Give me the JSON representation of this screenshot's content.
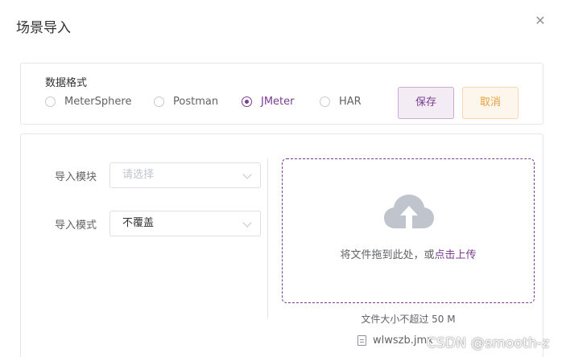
{
  "dialog": {
    "title": "场景导入",
    "close_icon": "close-icon"
  },
  "format": {
    "label": "数据格式",
    "options": [
      {
        "label": "MeterSphere",
        "selected": false
      },
      {
        "label": "Postman",
        "selected": false
      },
      {
        "label": "JMeter",
        "selected": true
      },
      {
        "label": "HAR",
        "selected": false
      }
    ],
    "save_label": "保存",
    "cancel_label": "取消"
  },
  "form": {
    "module_label": "导入模块",
    "module_placeholder": "请选择",
    "mode_label": "导入模式",
    "mode_value": "不覆盖"
  },
  "upload": {
    "icon": "cloud-upload-icon",
    "text_prefix": "将文件拖到此处，或",
    "text_link": "点击上传",
    "tip": "文件大小不超过 50 M",
    "file_name": "wlwszb.jmx"
  },
  "watermark": "CSDN @smooth-z",
  "colors": {
    "accent": "#7a3d91",
    "warning": "#e6a23c",
    "border": "#e4e7ed"
  }
}
